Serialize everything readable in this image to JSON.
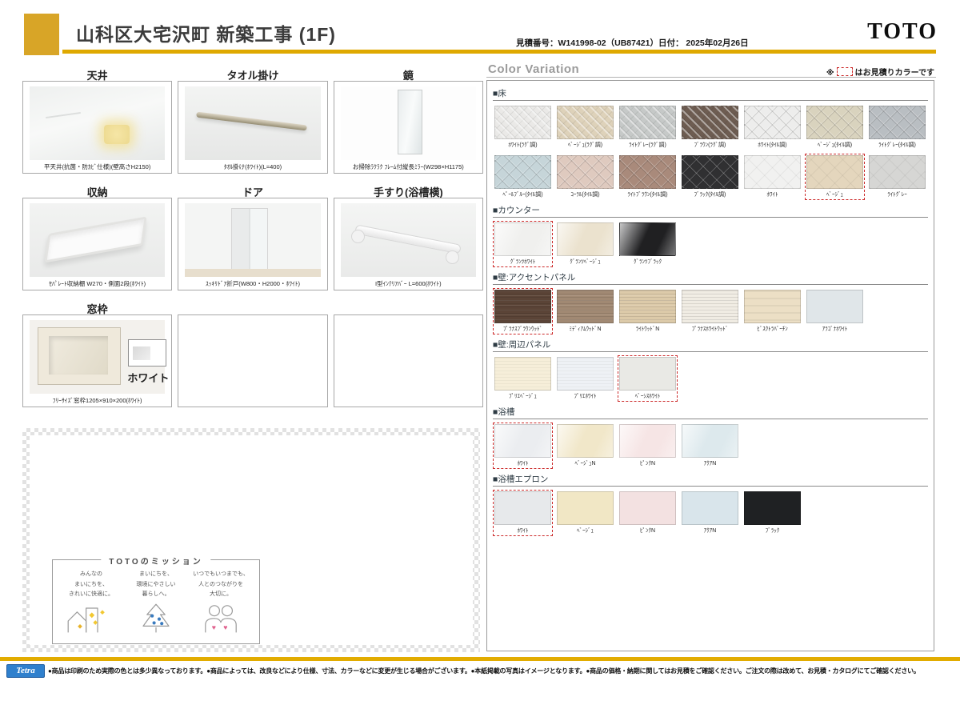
{
  "header": {
    "title": "山科区大宅沢町 新築工事 (1F)",
    "quote": "見積番号：W141998-02（UB87421）日付： 2025年02月26日",
    "brand": "TOTO",
    "accent_color": "#DFA900"
  },
  "products": {
    "cells": [
      {
        "title": "天井",
        "caption": "平天井(抗菌・防ｶﾋﾞ仕様)(壁高さH2150)",
        "image": "ceiling"
      },
      {
        "title": "タオル掛け",
        "caption": "ﾀｵﾙ掛け(ﾎﾜｲﾄ)(L=400)",
        "image": "towel"
      },
      {
        "title": "鏡",
        "caption": "お掃除ﾗｸﾗｸ ﾌﾚｰﾑ付縦長ﾐﾗｰ(W298×H1175)",
        "image": "mirror"
      },
      {
        "title": "収納",
        "caption": "ｾﾊﾟﾚｰﾄ収納棚 W270・側面2段(ﾎﾜｲﾄ)",
        "image": "shelf"
      },
      {
        "title": "ドア",
        "caption": "ｽｯｷﾘﾄﾞｱ折戸(W800・H2000・ﾎﾜｲﾄ)",
        "image": "door"
      },
      {
        "title": "手すり(浴槽横)",
        "caption": "I型ｲﾝﾃﾘｱﾊﾞｰ L=600(ﾎﾜｲﾄ)",
        "image": "grab"
      },
      {
        "title": "窓枠",
        "caption": "ﾌﾘｰｻｲｽﾞ窓枠1205×910×200(ﾎﾜｲﾄ)",
        "image": "window",
        "swatch_label": "ホワイト"
      },
      {
        "title": "",
        "caption": "",
        "image": "empty"
      },
      {
        "title": "",
        "caption": "",
        "image": "empty"
      }
    ]
  },
  "color_variation": {
    "heading": "Color Variation",
    "legend_prefix": "※",
    "legend_text": "はお見積りカラーです",
    "selected_border_color": "#cc2a2a",
    "sections": [
      {
        "label": "■床",
        "rows": [
          [
            {
              "name": "ﾎﾜｲﾄ(ﾗｸﾞ調)",
              "color": "#eae9e7",
              "texture": "rug",
              "selected": false
            },
            {
              "name": "ﾍﾞｰｼﾞｭ(ﾗｸﾞ調)",
              "color": "#ded2ba",
              "texture": "rug",
              "selected": false
            },
            {
              "name": "ﾗｲﾄｸﾞﾚｰ(ﾗｸﾞ調)",
              "color": "#c6c9c8",
              "texture": "rug",
              "selected": false
            },
            {
              "name": "ﾌﾞﾗｳﾝ(ﾗｸﾞ調)",
              "color": "#6e5d52",
              "texture": "rug",
              "selected": false
            },
            {
              "name": "ﾎﾜｲﾄ(ﾀｲﾙ調)",
              "color": "#ededec",
              "texture": "tile",
              "selected": false
            },
            {
              "name": "ﾍﾞｰｼﾞｭ(ﾀｲﾙ調)",
              "color": "#d9d3be",
              "texture": "tile",
              "selected": false
            },
            {
              "name": "ﾗｲﾄｸﾞﾚｰ(ﾀｲﾙ調)",
              "color": "#b9bec2",
              "texture": "tile",
              "selected": false
            }
          ],
          [
            {
              "name": "ﾍﾟｰﾙﾌﾞﾙｰ(ﾀｲﾙ調)",
              "color": "#c6d5d9",
              "texture": "tile",
              "selected": false
            },
            {
              "name": "ｺｰﾗﾙ(ﾀｲﾙ調)",
              "color": "#dfcabf",
              "texture": "tile",
              "selected": false
            },
            {
              "name": "ﾗｲﾄﾌﾞﾗｳﾝ(ﾀｲﾙ調)",
              "color": "#a98a7b",
              "texture": "tile",
              "selected": false
            },
            {
              "name": "ﾌﾞﾗｯｸ(ﾀｲﾙ調)",
              "color": "#303032",
              "texture": "tile",
              "selected": false
            },
            {
              "name": "ﾎﾜｲﾄ",
              "color": "#f1f1f0",
              "texture": "diamond",
              "selected": false
            },
            {
              "name": "ﾍﾞｰｼﾞｭ",
              "color": "#e4d6bd",
              "texture": "diamond",
              "selected": true
            },
            {
              "name": "ﾗｲﾄｸﾞﾚｰ",
              "color": "#d6d6d4",
              "texture": "diamond",
              "selected": false
            }
          ]
        ]
      },
      {
        "label": "■カウンター",
        "rows": [
          [
            {
              "name": "ｸﾞﾗﾝﾂﾎﾜｲﾄ",
              "color": "#f0f0ee",
              "texture": "gloss",
              "selected": true
            },
            {
              "name": "ｸﾞﾗﾝﾂﾍﾞｰｼﾞｭ",
              "color": "#ebe2ce",
              "texture": "gloss",
              "selected": false
            },
            {
              "name": "ｸﾞﾗﾝﾂﾌﾞﾗｯｸ",
              "color": "#202022",
              "texture": "gloss",
              "selected": false
            }
          ]
        ]
      },
      {
        "label": "■壁:アクセントパネル",
        "rows": [
          [
            {
              "name": "ﾌﾟﾗﾅｽﾌﾞﾗｳﾝｳｯﾄﾞ",
              "color": "#5b4437",
              "texture": "wood",
              "selected": true
            },
            {
              "name": "ﾐﾃﾞｨｱﾑｳｯﾄﾞN",
              "color": "#a18973",
              "texture": "wood",
              "selected": false
            },
            {
              "name": "ﾗｲﾄｳｯﾄﾞN",
              "color": "#dccaa9",
              "texture": "wood",
              "selected": false
            },
            {
              "name": "ﾌﾟﾗﾅｽﾎﾜｲﾄｳｯﾄﾞ",
              "color": "#f0ece3",
              "texture": "wood",
              "selected": false
            },
            {
              "name": "ﾋﾞｽｸﾄﾗﾊﾞｰﾁﾝ",
              "color": "#ecdfc5",
              "texture": "stone",
              "selected": false
            },
            {
              "name": "ｱﾗｺﾞﾅﾎﾜｲﾄ",
              "color": "#e0e6e9",
              "texture": "plain",
              "selected": false
            }
          ]
        ]
      },
      {
        "label": "■壁:周辺パネル",
        "rows": [
          [
            {
              "name": "ﾌﾟﾘｴﾍﾞｰｼﾞｭ",
              "color": "#f6eed9",
              "texture": "lines",
              "selected": false
            },
            {
              "name": "ﾌﾟﾘｴﾎﾜｲﾄ",
              "color": "#eef1f5",
              "texture": "lines",
              "selected": false
            },
            {
              "name": "ﾍﾞｰｼｽﾎﾜｲﾄ",
              "color": "#e9e9e5",
              "texture": "plain",
              "selected": true
            }
          ]
        ]
      },
      {
        "label": "■浴槽",
        "rows": [
          [
            {
              "name": "ﾎﾜｲﾄ",
              "color": "#ebedf0",
              "texture": "gloss",
              "selected": true
            },
            {
              "name": "ﾍﾞｰｼﾞｭN",
              "color": "#f1e7c9",
              "texture": "gloss",
              "selected": false
            },
            {
              "name": "ﾋﾟﾝｸN",
              "color": "#f6e5e5",
              "texture": "gloss",
              "selected": false
            },
            {
              "name": "ｱｸｱN",
              "color": "#dde9ed",
              "texture": "gloss",
              "selected": false
            }
          ]
        ]
      },
      {
        "label": "■浴槽エプロン",
        "rows": [
          [
            {
              "name": "ﾎﾜｲﾄ",
              "color": "#e7e9eb",
              "texture": "plain",
              "selected": true
            },
            {
              "name": "ﾍﾞｰｼﾞｭ",
              "color": "#f1e7c5",
              "texture": "plain",
              "selected": false
            },
            {
              "name": "ﾋﾟﾝｸN",
              "color": "#f3e1e1",
              "texture": "plain",
              "selected": false
            },
            {
              "name": "ｱｸｱN",
              "color": "#d9e5eb",
              "texture": "plain",
              "selected": false
            },
            {
              "name": "ﾌﾞﾗｯｸ",
              "color": "#1f2123",
              "texture": "plain",
              "selected": false
            }
          ]
        ]
      }
    ]
  },
  "mission": {
    "title": "TOTOのミッション",
    "items": [
      {
        "text": "みんなの\nまいにちを、\nきれいに快適に。"
      },
      {
        "text": "まいにちを、\n環境にやさしい\n暮らしへ。"
      },
      {
        "text": "いつでもいつまでも、\n人とのつながりを\n大切に。"
      }
    ]
  },
  "footer": {
    "brand": "Tetra",
    "disclaimer": "●商品は印刷のため実際の色とは多少異なっております。●商品によっては、改良などにより仕様、寸法、カラーなどに変更が生じる場合がございます。●本紙掲載の写真はイメージとなります。●商品の価格・納期に関してはお見積をご確認ください。ご注文の際は改めて、お見積・カタログにてご確認ください。"
  }
}
